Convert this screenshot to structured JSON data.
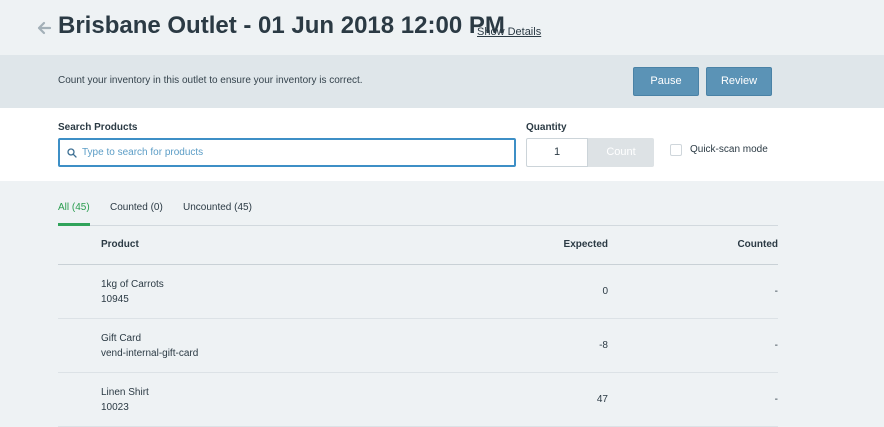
{
  "header": {
    "title": "Brisbane Outlet - 01 Jun 2018 12:00 PM",
    "show_details": "Show Details"
  },
  "info": {
    "text": "Count your inventory in this outlet to ensure your inventory is correct.",
    "pause_label": "Pause",
    "review_label": "Review"
  },
  "search": {
    "label": "Search Products",
    "placeholder": "Type to search for products",
    "quantity_label": "Quantity",
    "quantity_value": "1",
    "count_label": "Count",
    "quick_scan_label": "Quick-scan mode"
  },
  "tabs": [
    {
      "label": "All (45)",
      "active": true
    },
    {
      "label": "Counted (0)",
      "active": false
    },
    {
      "label": "Uncounted (45)",
      "active": false
    }
  ],
  "table": {
    "columns": [
      "Product",
      "Expected",
      "Counted"
    ],
    "rows": [
      {
        "name": "1kg of Carrots",
        "sku": "10945",
        "expected": "0",
        "counted": "-"
      },
      {
        "name": "Gift Card",
        "sku": "vend-internal-gift-card",
        "expected": "-8",
        "counted": "-"
      },
      {
        "name": "Linen Shirt",
        "sku": "10023",
        "expected": "47",
        "counted": "-"
      }
    ]
  },
  "colors": {
    "primary_button": "#5b93b6",
    "active_tab": "#2a9d4f",
    "focus_border": "#3d8fc6"
  }
}
